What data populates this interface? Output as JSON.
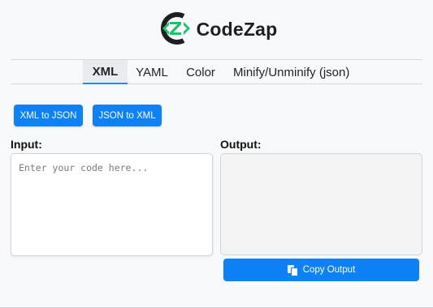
{
  "brand": {
    "name": "CodeZap",
    "logo_letters": "CZ",
    "accent": "#19c46a",
    "dark": "#1f1f1f"
  },
  "tabs": [
    {
      "label": "XML",
      "active": true
    },
    {
      "label": "YAML",
      "active": false
    },
    {
      "label": "Color",
      "active": false
    },
    {
      "label": "Minify/Unminify (json)",
      "active": false
    }
  ],
  "actions": {
    "xml_to_json": "XML to JSON",
    "json_to_xml": "JSON to XML"
  },
  "input": {
    "label": "Input:",
    "placeholder": "Enter your code here...",
    "value": ""
  },
  "output": {
    "label": "Output:",
    "value": ""
  },
  "copy": {
    "label": "Copy Output",
    "icon": "copy-icon"
  },
  "colors": {
    "primary": "#0d82f8",
    "tab_active_bg": "#e9ecef",
    "tab_active_border": "#1a8cff"
  }
}
